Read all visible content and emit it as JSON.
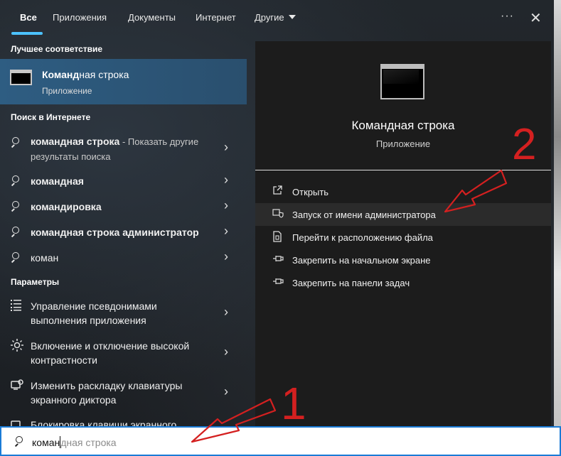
{
  "tabs": [
    {
      "label": "Все"
    },
    {
      "label": "Приложения"
    },
    {
      "label": "Документы"
    },
    {
      "label": "Интернет"
    },
    {
      "label": "Другие"
    }
  ],
  "sections": {
    "best_match": "Лучшее соответствие",
    "web": "Поиск в Интернете",
    "settings": "Параметры"
  },
  "best_match": {
    "title_bold": "Команд",
    "title_rest": "ная строка",
    "subtitle": "Приложение"
  },
  "web_results": [
    {
      "bold": "командная строка",
      "rest": " - Показать другие",
      "line2": "результаты поиска"
    },
    {
      "bold": "командная",
      "rest": ""
    },
    {
      "bold": "командировка",
      "rest": ""
    },
    {
      "bold": "командная строка администратор",
      "rest": ""
    },
    {
      "bold": "",
      "rest": "коман"
    }
  ],
  "settings_results": [
    {
      "line1": "Управление псевдонимами",
      "line2": "выполнения приложения",
      "icon": "list-icon"
    },
    {
      "line1": "Включение и отключение высокой",
      "line2": "контрастности",
      "icon": "brightness-icon"
    },
    {
      "line1": "Изменить раскладку клавиатуры",
      "line2": "экранного диктора",
      "icon": "narrator-icon"
    },
    {
      "line1": "Блокировка клавиши экранного",
      "line2": "",
      "icon": "narrator-icon"
    }
  ],
  "preview": {
    "title": "Командная строка",
    "subtitle": "Приложение"
  },
  "actions": [
    {
      "label": "Открыть",
      "icon": "open-icon"
    },
    {
      "label": "Запуск от имени администратора",
      "icon": "shield-icon"
    },
    {
      "label": "Перейти к расположению файла",
      "icon": "file-location-icon"
    },
    {
      "label": "Закрепить на начальном экране",
      "icon": "pin-icon"
    },
    {
      "label": "Закрепить на панели задач",
      "icon": "pin-icon"
    }
  ],
  "search": {
    "typed": "коман",
    "suggestion_rest": "дная строка"
  },
  "annotations": {
    "one": "1",
    "two": "2",
    "color": "#d42020"
  },
  "colors": {
    "accent": "#4cc2ff",
    "selection": "#2e5d82"
  }
}
